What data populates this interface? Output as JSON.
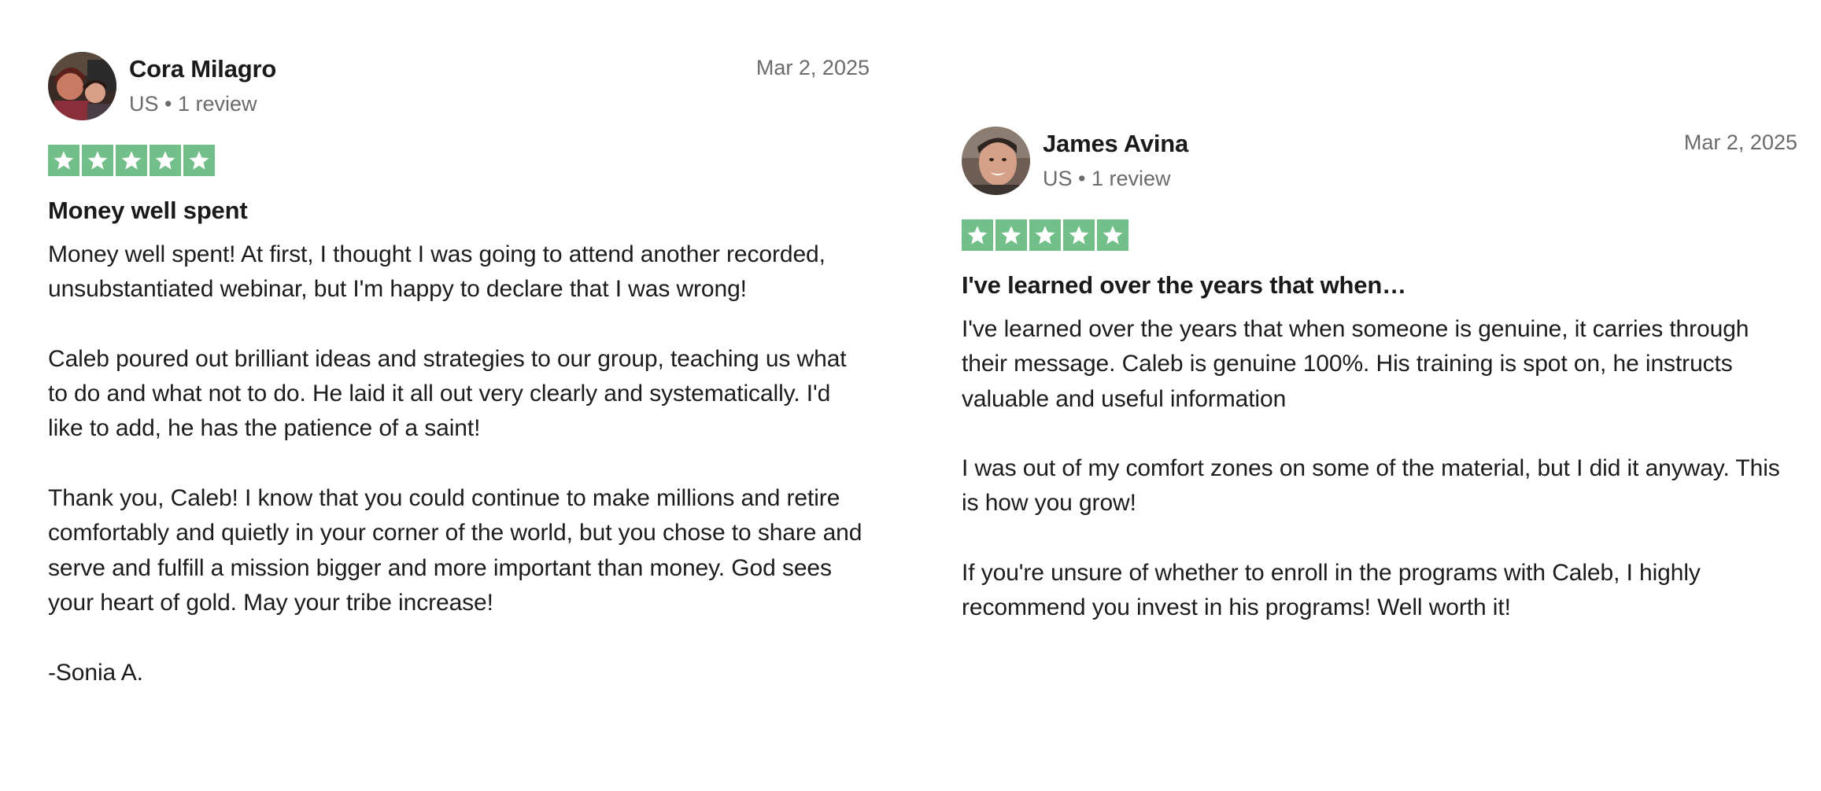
{
  "reviews": [
    {
      "name": "Cora Milagro",
      "meta": "US • 1 review",
      "date": "Mar 2, 2025",
      "rating": 5,
      "title": "Money well spent",
      "paragraphs": [
        "Money well spent! At first, I thought I was going to attend another recorded, unsubstantiated webinar, but I'm happy to declare that I was wrong!",
        "Caleb poured out brilliant ideas and strategies to our group, teaching us what to do and what not to do. He laid it all out very clearly and systematically. I'd like to add, he has the patience of a saint!",
        "Thank you, Caleb! I know that you could continue to make millions and retire comfortably and quietly in your corner of the world, but you chose to share and serve and fulfill a mission bigger and more important than money. God sees your heart of gold. May your tribe increase!",
        "-Sonia A."
      ]
    },
    {
      "name": "James Avina",
      "meta": "US • 1 review",
      "date": "Mar 2, 2025",
      "rating": 5,
      "title": "I've learned over the years that when…",
      "paragraphs": [
        "I've learned over the years that when someone is genuine, it carries through their message. Caleb is genuine 100%. His training is spot on, he instructs valuable and useful information",
        "I was out of my comfort zones on some of the material, but I did it anyway. This is how you grow!",
        "If you're unsure of whether to enroll in the programs with Caleb, I highly recommend you invest in his programs! Well worth it!"
      ]
    }
  ],
  "colors": {
    "star_background": "#73bf8a",
    "star_fill": "#ffffff",
    "meta_text": "#6b6b6b"
  },
  "icons": {
    "star": "star-icon",
    "avatar": "avatar-photo"
  }
}
